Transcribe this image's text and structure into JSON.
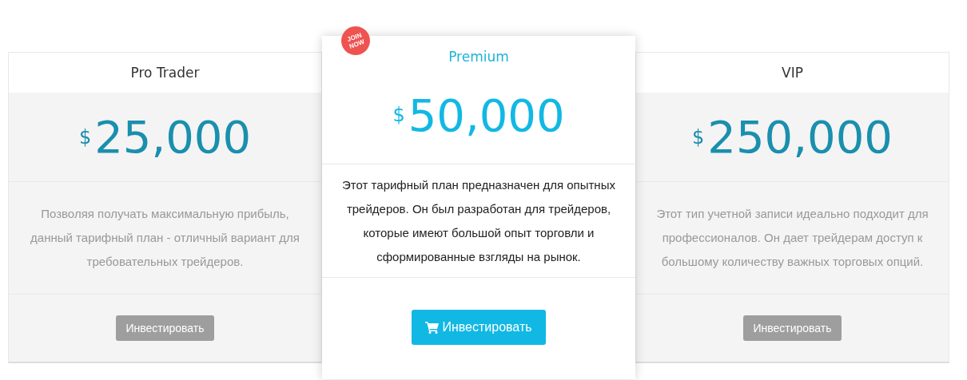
{
  "plans": [
    {
      "name": "Pro Trader",
      "currency": "$",
      "price": "25,000",
      "description": "Позволяя получать максимальную прибыль, данный тарифный план - отличный вариант для требовательных трейдеров.",
      "button": "Инвестировать",
      "featured": false
    },
    {
      "name": "Premium",
      "currency": "$",
      "price": "50,000",
      "description": "Этот тарифный план предназначен для опытных трейдеров. Он был разработан для трейдеров, которые имеют большой опыт торговли и сформированные взгляды на рынок.",
      "button": "Инвестировать",
      "featured": true,
      "badge": "JOIN NOW"
    },
    {
      "name": "VIP",
      "currency": "$",
      "price": "250,000",
      "description": "Этот тип учетной записи идеально подходит для профессионалов. Он дает трейдерам доступ к большому количеству важных торговых опций.",
      "button": "Инвестировать",
      "featured": false
    }
  ]
}
